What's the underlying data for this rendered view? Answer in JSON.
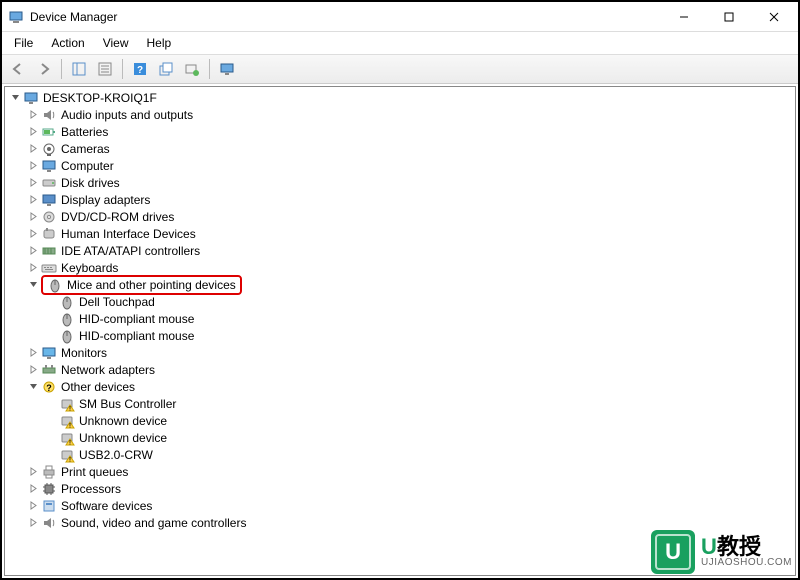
{
  "window": {
    "title": "Device Manager"
  },
  "menu": {
    "file": "File",
    "action": "Action",
    "view": "View",
    "help": "Help"
  },
  "tree": {
    "root": "DESKTOP-KROIQ1F",
    "items": [
      {
        "label": "Audio inputs and outputs",
        "icon": "audio",
        "expanded": false
      },
      {
        "label": "Batteries",
        "icon": "battery",
        "expanded": false
      },
      {
        "label": "Cameras",
        "icon": "camera",
        "expanded": false
      },
      {
        "label": "Computer",
        "icon": "computer",
        "expanded": false
      },
      {
        "label": "Disk drives",
        "icon": "disk",
        "expanded": false
      },
      {
        "label": "Display adapters",
        "icon": "display",
        "expanded": false
      },
      {
        "label": "DVD/CD-ROM drives",
        "icon": "dvd",
        "expanded": false
      },
      {
        "label": "Human Interface Devices",
        "icon": "hid",
        "expanded": false
      },
      {
        "label": "IDE ATA/ATAPI controllers",
        "icon": "ide",
        "expanded": false
      },
      {
        "label": "Keyboards",
        "icon": "keyboard",
        "expanded": false
      },
      {
        "label": "Mice and other pointing devices",
        "icon": "mouse",
        "expanded": true,
        "highlighted": true,
        "children": [
          {
            "label": "Dell Touchpad",
            "icon": "mouse"
          },
          {
            "label": "HID-compliant mouse",
            "icon": "mouse"
          },
          {
            "label": "HID-compliant mouse",
            "icon": "mouse"
          }
        ]
      },
      {
        "label": "Monitors",
        "icon": "monitor",
        "expanded": false
      },
      {
        "label": "Network adapters",
        "icon": "network",
        "expanded": false
      },
      {
        "label": "Other devices",
        "icon": "other",
        "expanded": true,
        "children": [
          {
            "label": "SM Bus Controller",
            "icon": "warning"
          },
          {
            "label": "Unknown device",
            "icon": "warning"
          },
          {
            "label": "Unknown device",
            "icon": "warning"
          },
          {
            "label": "USB2.0-CRW",
            "icon": "warning"
          }
        ]
      },
      {
        "label": "Print queues",
        "icon": "printer",
        "expanded": false
      },
      {
        "label": "Processors",
        "icon": "processor",
        "expanded": false
      },
      {
        "label": "Software devices",
        "icon": "software",
        "expanded": false
      },
      {
        "label": "Sound, video and game controllers",
        "icon": "sound",
        "expanded": false
      }
    ]
  },
  "watermark": {
    "badge": "U",
    "title_prefix": "U",
    "title_suffix": "教授",
    "url": "UJIAOSHOU.COM"
  }
}
